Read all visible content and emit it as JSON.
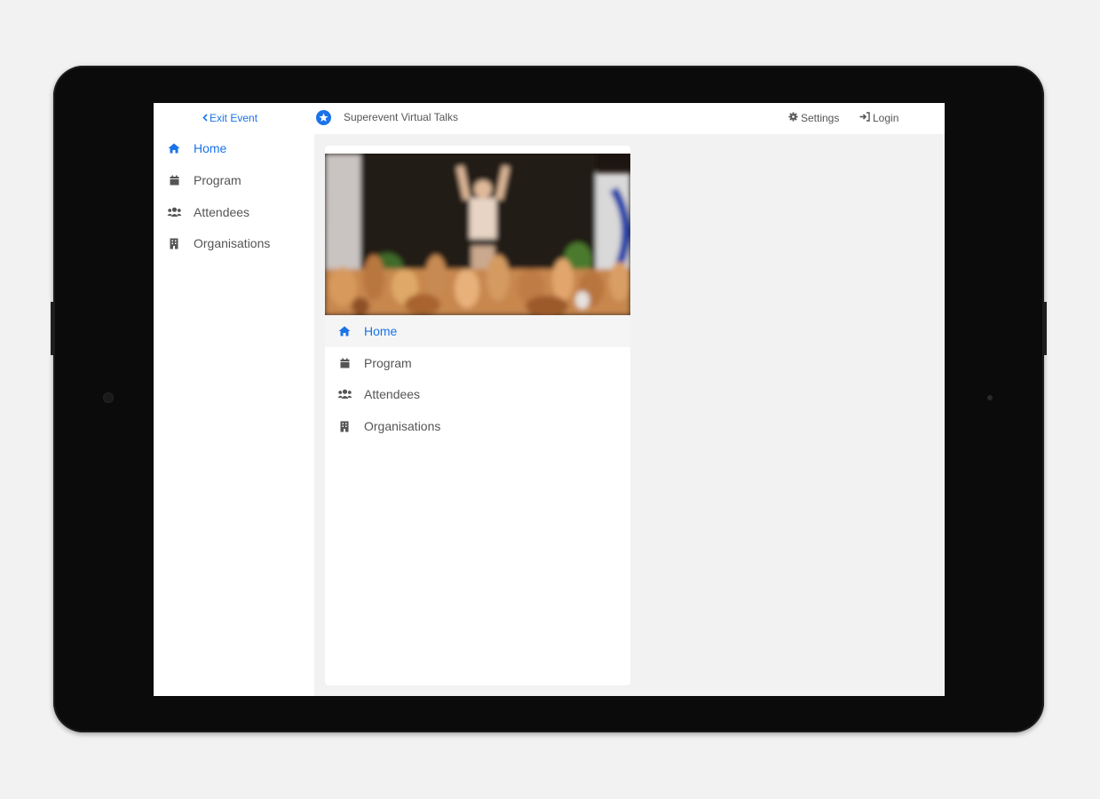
{
  "topbar": {
    "exit_label": "Exit Event",
    "event_title": "Superevent Virtual Talks",
    "settings_label": "Settings",
    "login_label": "Login"
  },
  "sidebar": {
    "items": [
      {
        "label": "Home",
        "icon": "home-icon",
        "active": true
      },
      {
        "label": "Program",
        "icon": "calendar-icon",
        "active": false
      },
      {
        "label": "Attendees",
        "icon": "users-icon",
        "active": false
      },
      {
        "label": "Organisations",
        "icon": "building-icon",
        "active": false
      }
    ]
  },
  "card": {
    "items": [
      {
        "label": "Home",
        "icon": "home-icon",
        "active": true
      },
      {
        "label": "Program",
        "icon": "calendar-icon",
        "active": false
      },
      {
        "label": "Attendees",
        "icon": "users-icon",
        "active": false
      },
      {
        "label": "Organisations",
        "icon": "building-icon",
        "active": false
      }
    ]
  },
  "colors": {
    "accent": "#1a73e8",
    "text": "#555555",
    "background": "#f2f2f2"
  }
}
